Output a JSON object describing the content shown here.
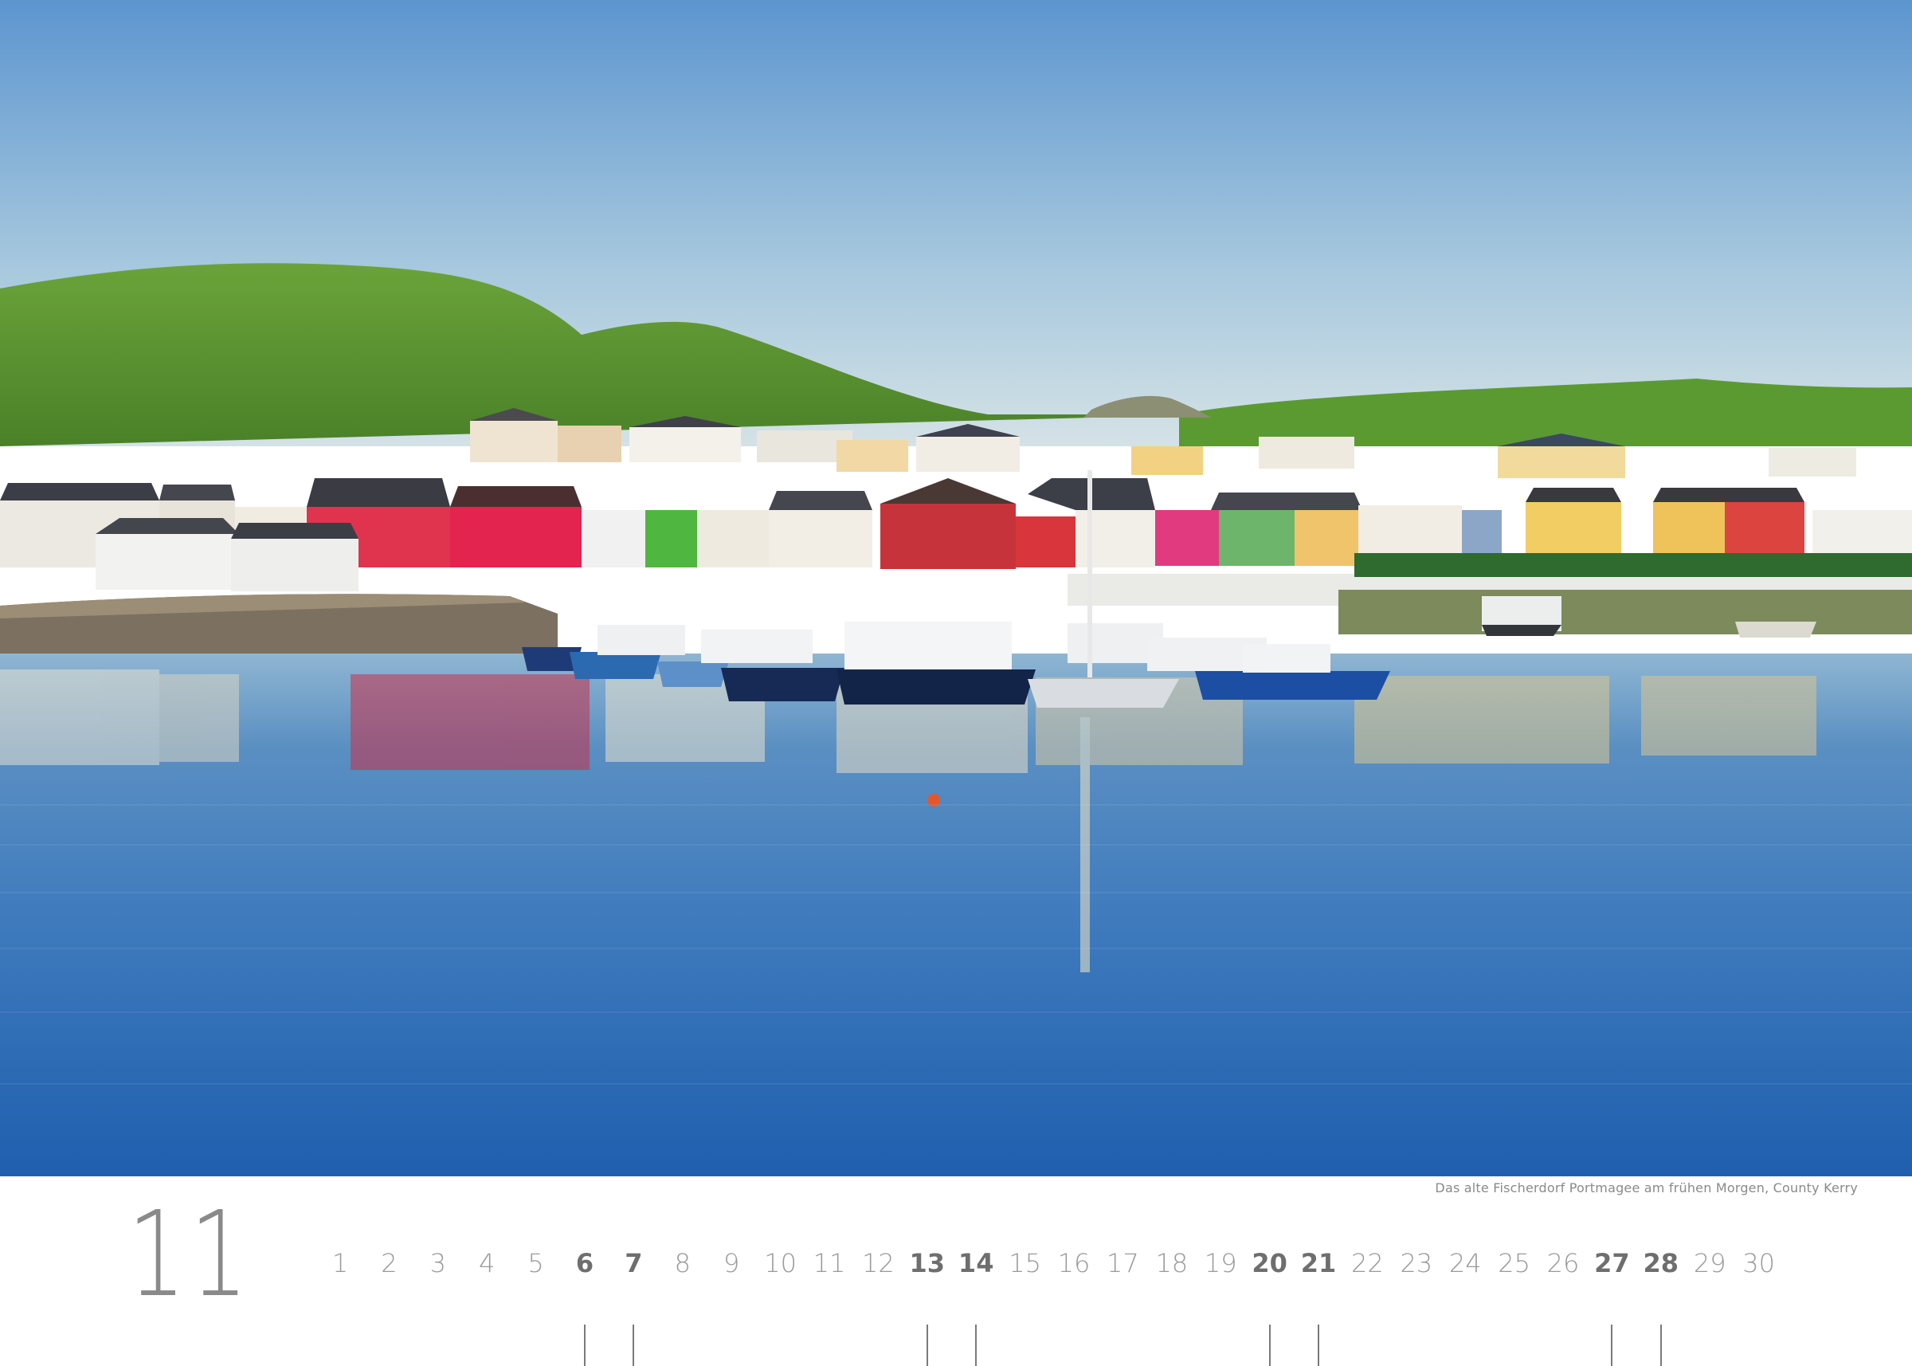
{
  "caption": "Das alte Fischerdorf Portmagee am frühen Morgen, County Kerry",
  "month_number": "11",
  "days": [
    {
      "label": "1",
      "weekend": false
    },
    {
      "label": "2",
      "weekend": false
    },
    {
      "label": "3",
      "weekend": false
    },
    {
      "label": "4",
      "weekend": false
    },
    {
      "label": "5",
      "weekend": false
    },
    {
      "label": "6",
      "weekend": true
    },
    {
      "label": "7",
      "weekend": true
    },
    {
      "label": "8",
      "weekend": false
    },
    {
      "label": "9",
      "weekend": false
    },
    {
      "label": "10",
      "weekend": false
    },
    {
      "label": "11",
      "weekend": false
    },
    {
      "label": "12",
      "weekend": false
    },
    {
      "label": "13",
      "weekend": true
    },
    {
      "label": "14",
      "weekend": true
    },
    {
      "label": "15",
      "weekend": false
    },
    {
      "label": "16",
      "weekend": false
    },
    {
      "label": "17",
      "weekend": false
    },
    {
      "label": "18",
      "weekend": false
    },
    {
      "label": "19",
      "weekend": false
    },
    {
      "label": "20",
      "weekend": true
    },
    {
      "label": "21",
      "weekend": true
    },
    {
      "label": "22",
      "weekend": false
    },
    {
      "label": "23",
      "weekend": false
    },
    {
      "label": "24",
      "weekend": false
    },
    {
      "label": "25",
      "weekend": false
    },
    {
      "label": "26",
      "weekend": false
    },
    {
      "label": "27",
      "weekend": true
    },
    {
      "label": "28",
      "weekend": true
    },
    {
      "label": "29",
      "weekend": false
    },
    {
      "label": "30",
      "weekend": false
    }
  ],
  "colors": {
    "sky_top": "#5d96cf",
    "sky_bottom": "#c9dde8",
    "hill": "#5f9a32",
    "water": "#2f6fb8",
    "text_gray": "#8a8a8a"
  }
}
